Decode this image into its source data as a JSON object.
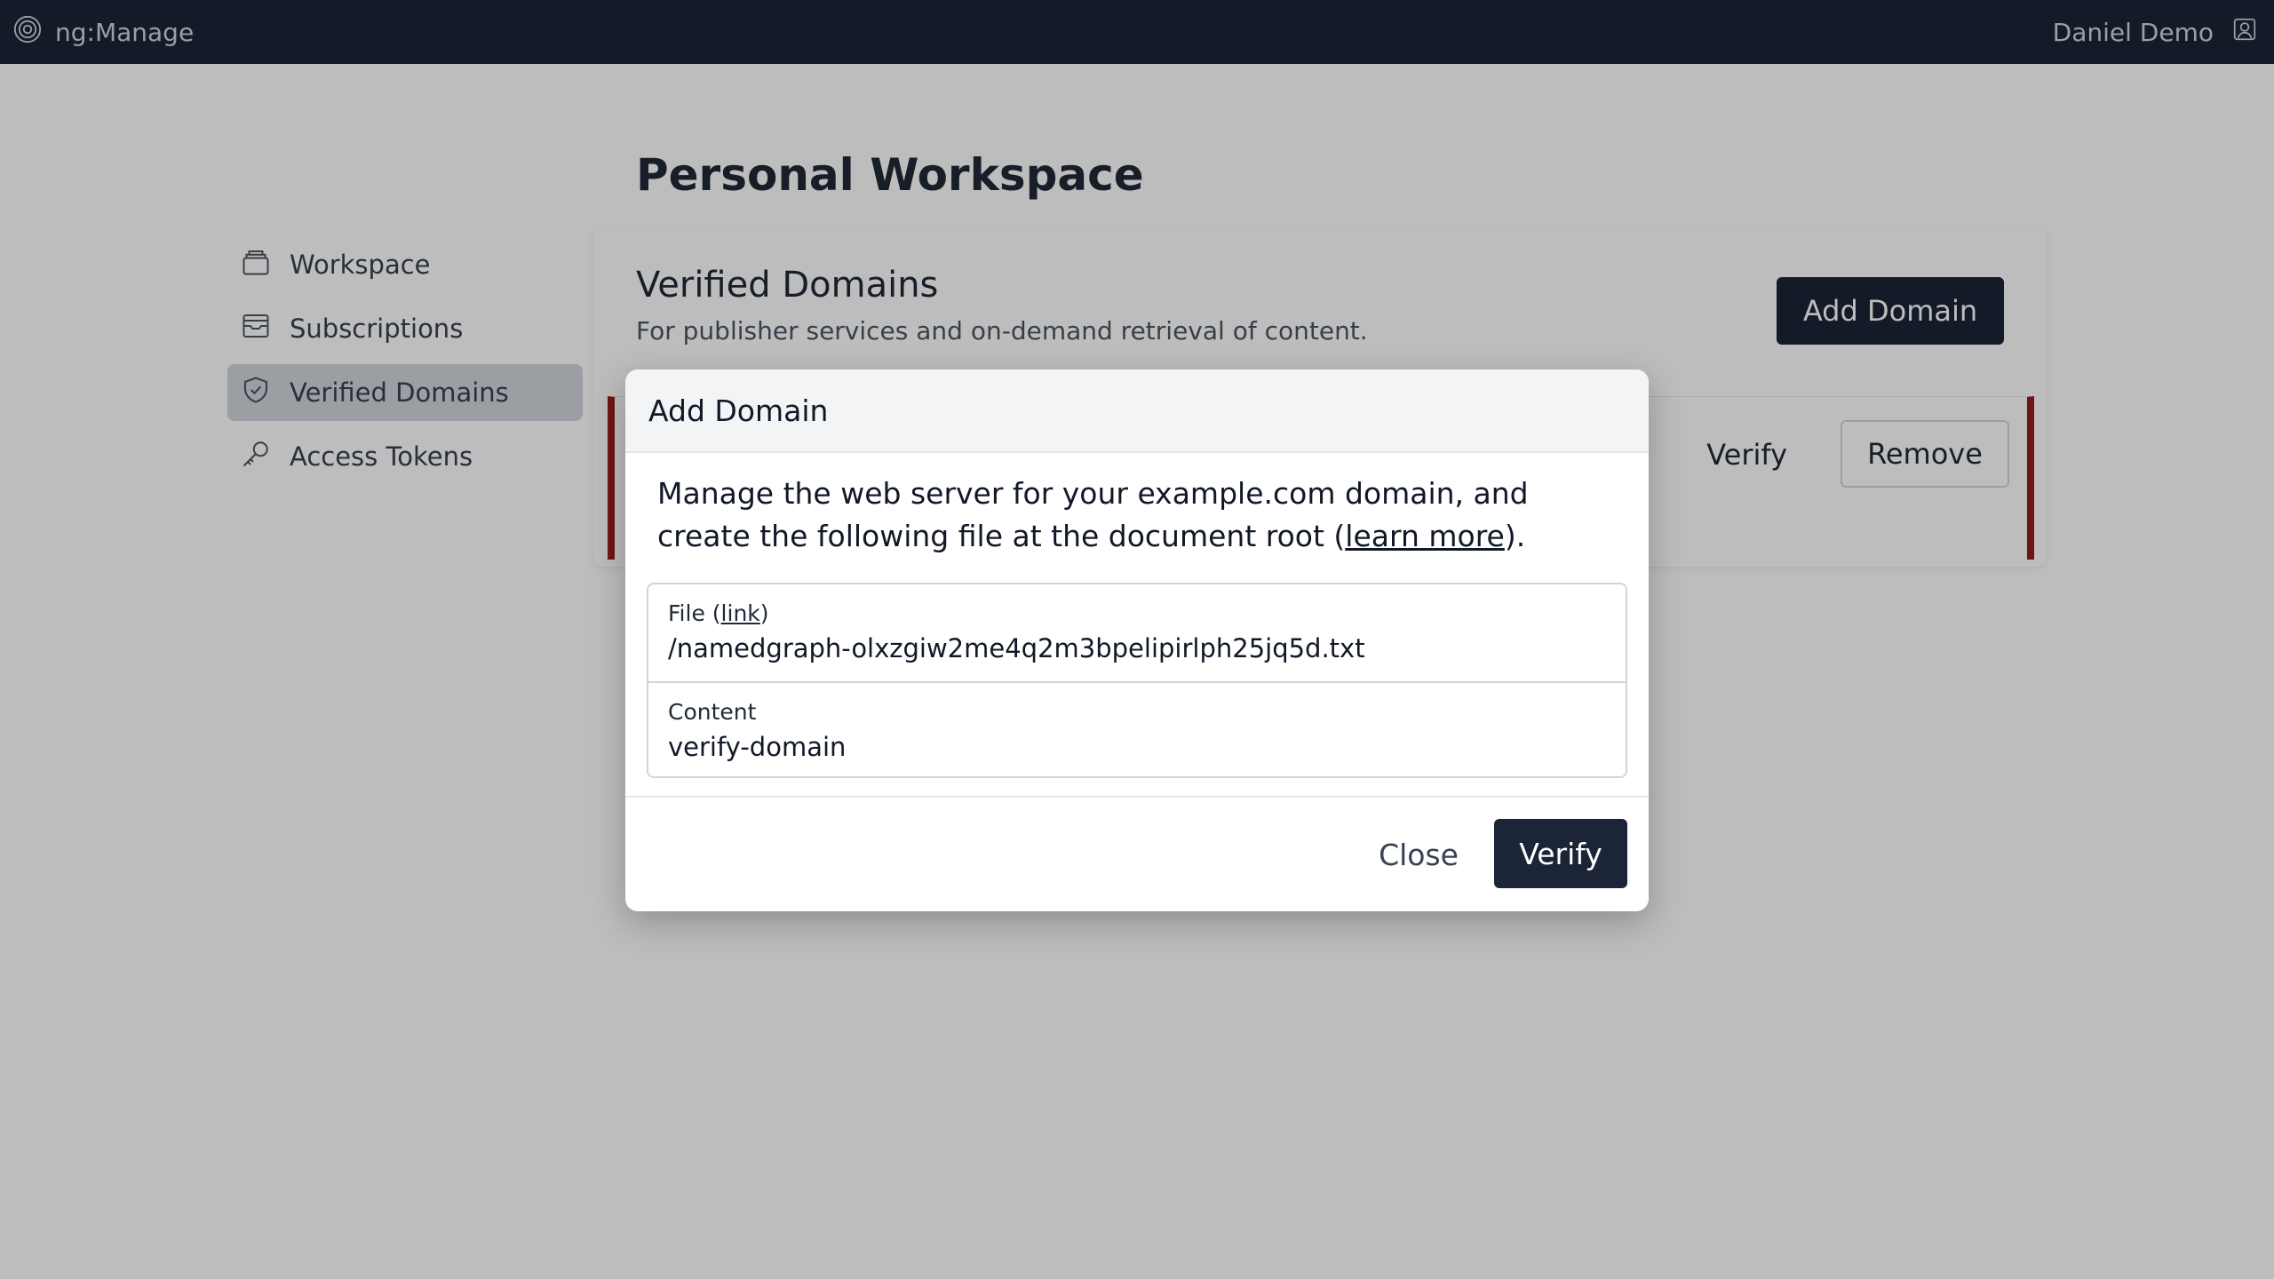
{
  "topbar": {
    "app_name": "ng:Manage",
    "user_name": "Daniel Demo"
  },
  "page": {
    "title": "Personal Workspace"
  },
  "sidebar": {
    "items": [
      {
        "label": "Workspace",
        "icon": "box-icon"
      },
      {
        "label": "Subscriptions",
        "icon": "inbox-icon"
      },
      {
        "label": "Verified Domains",
        "icon": "shield-check-icon",
        "active": true
      },
      {
        "label": "Access Tokens",
        "icon": "key-icon"
      }
    ]
  },
  "card": {
    "title": "Verified Domains",
    "description": "For publisher services and on-demand retrieval of content.",
    "add_button": "Add Domain",
    "row": {
      "verify_label": "Verify",
      "remove_label": "Remove"
    }
  },
  "modal": {
    "title": "Add Domain",
    "text_before": "Manage the web server for your example.com domain, and create the following file at the document root (",
    "learn_more": "learn more",
    "text_after": ").",
    "file_label_prefix": "File (",
    "file_link": "link",
    "file_label_suffix": ")",
    "file_value": "/namedgraph-olxzgiw2me4q2m3bpelipirlph25jq5d.txt",
    "content_label": "Content",
    "content_value": "verify-domain",
    "close_label": "Close",
    "verify_label": "Verify"
  },
  "colors": {
    "navbar": "#1b2537",
    "primary_button": "#1b2537",
    "error_border": "#991b1b"
  }
}
